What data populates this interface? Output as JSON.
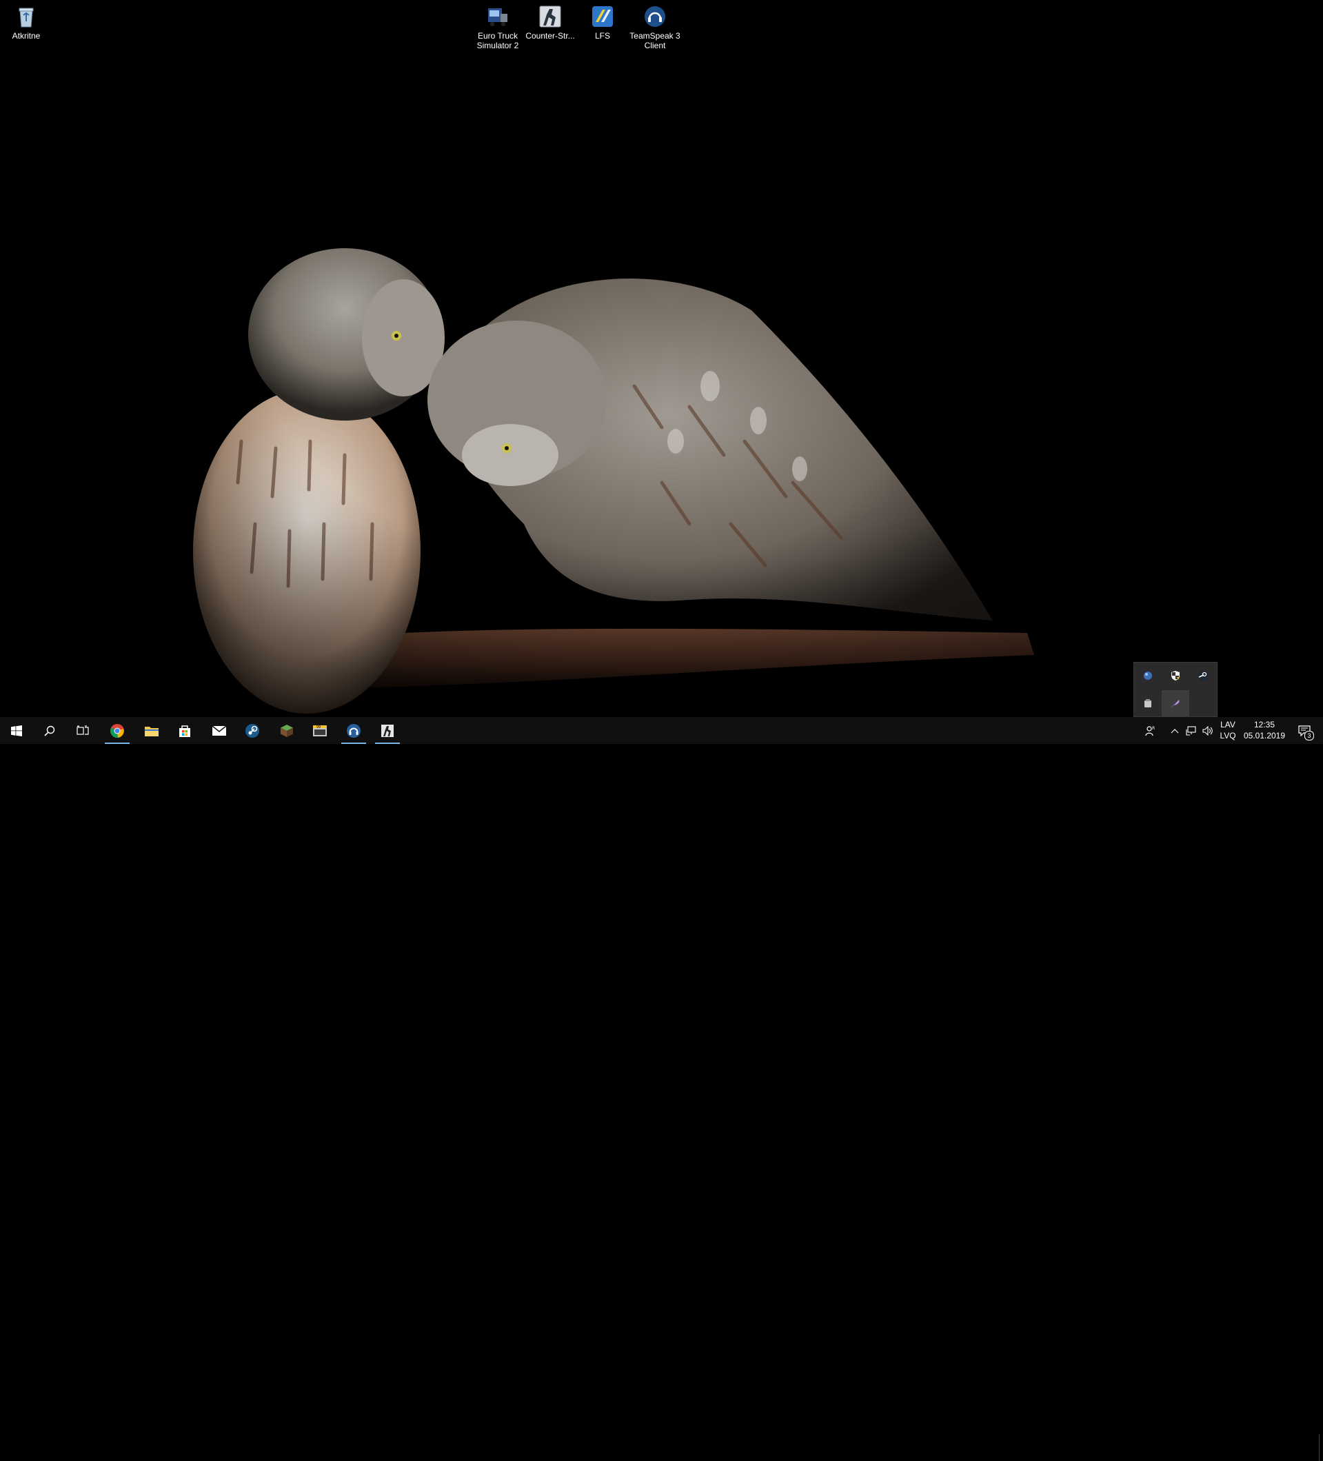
{
  "desktop": {
    "icons": [
      {
        "label": "Atkritne",
        "icon": "recycle-bin-icon"
      },
      {
        "label": "Euro Truck Simulator 2",
        "icon": "euro-truck-simulator-icon"
      },
      {
        "label": "Counter-Str...",
        "icon": "counter-strike-icon"
      },
      {
        "label": "LFS",
        "icon": "lfs-icon"
      },
      {
        "label": "TeamSpeak 3 Client",
        "icon": "teamspeak-icon"
      }
    ]
  },
  "taskbar": {
    "buttons": [
      {
        "name": "start",
        "icon": "windows-logo-icon"
      },
      {
        "name": "search",
        "icon": "search-icon"
      },
      {
        "name": "task-view",
        "icon": "task-view-icon"
      },
      {
        "name": "chrome",
        "icon": "chrome-icon"
      },
      {
        "name": "file-explorer",
        "icon": "folder-icon"
      },
      {
        "name": "store",
        "icon": "store-bag-icon"
      },
      {
        "name": "mail",
        "icon": "mail-icon"
      },
      {
        "name": "steam",
        "icon": "steam-icon"
      },
      {
        "name": "minecraft",
        "icon": "minecraft-block-icon"
      },
      {
        "name": "app-99",
        "icon": "terminal-app-icon"
      },
      {
        "name": "teamspeak",
        "icon": "teamspeak-icon"
      },
      {
        "name": "counter-strike",
        "icon": "counter-strike-icon"
      }
    ],
    "tray": {
      "language_line1": "LAV",
      "language_line2": "LVQ",
      "time": "12:35",
      "date": "05.01.2019",
      "notification_count": "3"
    }
  },
  "tray_popup": {
    "icons": [
      "blue-orb-icon",
      "security-shield-icon",
      "steam-tray-icon",
      "usb-drive-icon",
      "feather-pen-icon"
    ]
  },
  "colors": {
    "taskbar_bg": "#101010",
    "running_indicator": "#76b9ed",
    "desktop_bg": "#000000"
  }
}
